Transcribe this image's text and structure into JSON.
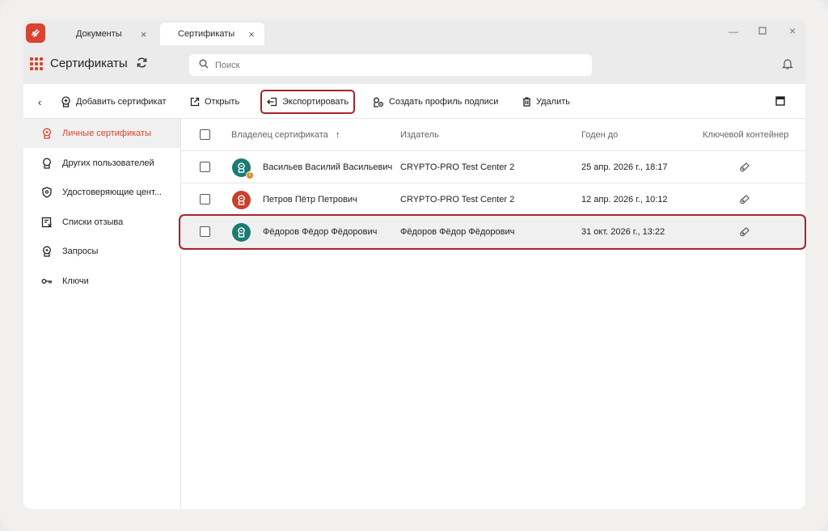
{
  "tabs": [
    {
      "label": "Документы"
    },
    {
      "label": "Сертификаты"
    }
  ],
  "header": {
    "title": "Сертификаты",
    "search_placeholder": "Поиск"
  },
  "toolbar": {
    "add_label": "Добавить сертификат",
    "open_label": "Открыть",
    "export_label": "Экспортировать",
    "create_profile_label": "Создать профиль подписи",
    "delete_label": "Удалить"
  },
  "sidebar": {
    "items": [
      {
        "label": "Личные сертификаты",
        "icon": "personal-cert-icon",
        "active": true
      },
      {
        "label": "Других пользователей",
        "icon": "other-users-icon"
      },
      {
        "label": "Удостоверяющие цент...",
        "icon": "shield-icon"
      },
      {
        "label": "Списки отзыва",
        "icon": "revocation-list-icon"
      },
      {
        "label": "Запросы",
        "icon": "request-icon"
      },
      {
        "label": "Ключи",
        "icon": "key-icon"
      }
    ]
  },
  "table": {
    "columns": {
      "owner": "Владелец сертификата",
      "sort_arrow": "↑",
      "issuer": "Издатель",
      "valid_until": "Годен до",
      "container": "Ключевой контейнер"
    },
    "rows": [
      {
        "owner": "Васильев Василий Васильевич",
        "issuer": "CRYPTO-PRO Test Center 2",
        "valid_until": "25 апр. 2026 г., 18:17",
        "avatar_color": "#1b7a72",
        "warning": true
      },
      {
        "owner": "Петров Пётр Петрович",
        "issuer": "CRYPTO-PRO Test Center 2",
        "valid_until": "12 апр. 2026 г., 10:12",
        "avatar_color": "#c9402e",
        "warning": false
      },
      {
        "owner": "Фёдоров Фёдор Фёдорович",
        "issuer": "Фёдоров Фёдор Фёдорович",
        "valid_until": "31 окт. 2026 г., 13:22",
        "avatar_color": "#1b7a72",
        "warning": false,
        "selected": true
      }
    ]
  },
  "colors": {
    "accent": "#d9432f",
    "highlight": "#a8232e",
    "teal": "#1b7a72"
  }
}
